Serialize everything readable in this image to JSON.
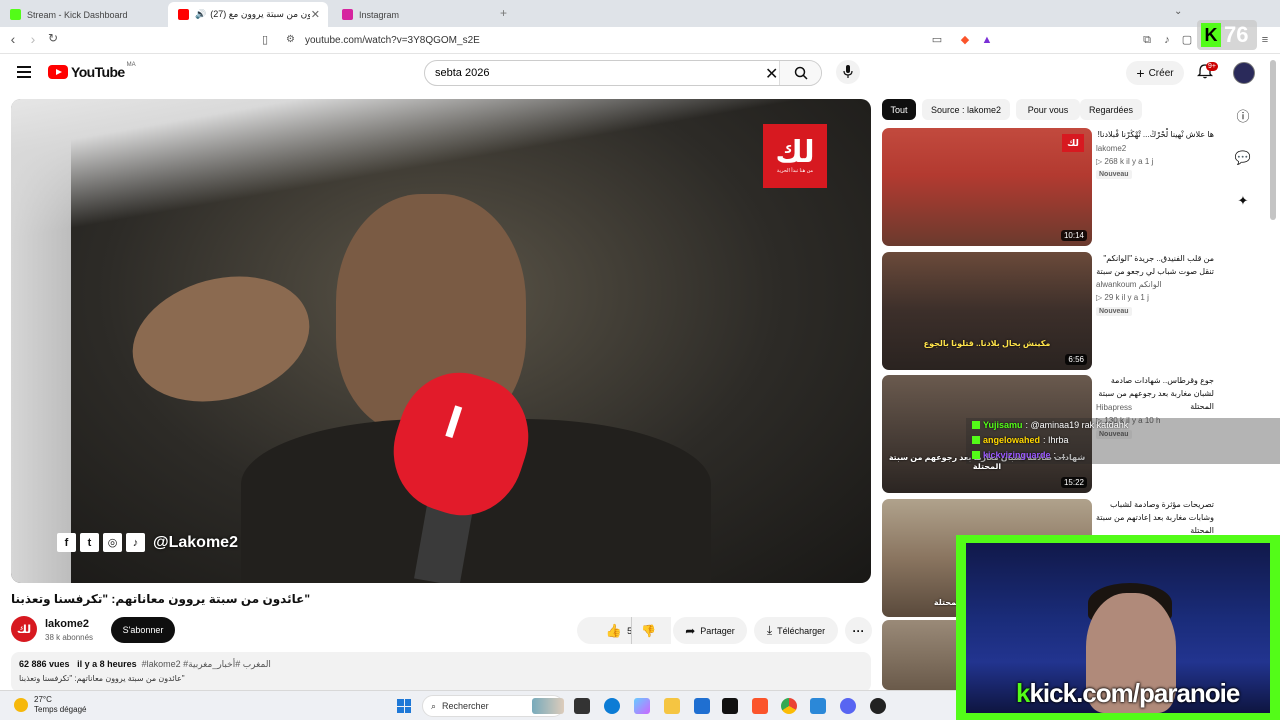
{
  "browser": {
    "tabs": [
      {
        "label": "Stream - Kick Dashboard",
        "color": "#53fc18"
      },
      {
        "label": "(27) عائدون من سبتة يروون مع...",
        "color": "#ff0000"
      },
      {
        "label": "Instagram",
        "color": "#d6249f"
      }
    ],
    "url": "youtube.com/watch?v=3Y8QGOM_s2E"
  },
  "youtube": {
    "logo_word": "YouTube",
    "country_code": "MA",
    "search_value": "sebta 2026",
    "create_label": "Créer",
    "notif_count": "9+"
  },
  "video": {
    "title": "عائدون من سبتة يروون معاناتهم: \"تكرفسنا وتعذبنا\"",
    "channel_bug": "لك",
    "channel_bug_sub": "من هنا تبدأ الحرية",
    "mic_letter": "ا",
    "social_handle": "@Lakome2",
    "channel_name": "lakome2",
    "channel_avatar_text": "لك",
    "subscribers": "38 k abonnés",
    "subscribe_label": "S'abonner",
    "likes": "552",
    "share_label": "Partager",
    "download_label": "Télécharger",
    "views": "62 886 vues",
    "age": "il y a 8 heures",
    "hashtags": "#lakome2 #المغرب #أخبار_مغربية",
    "desc_line": "عائدون من سبتة يروون معاناتهم: \"تكرفسنا وتعذبنا\""
  },
  "chips": [
    "Tout",
    "Source : lakome2",
    "Pour vous",
    "Regardées"
  ],
  "recommendations": [
    {
      "title": "ها علاش نْهينا لْحْرْڭ... تْهْڭرْنا فْبلادنا!",
      "channel": "lakome2",
      "meta": "▷ 268 k   il y a 1 j",
      "badge": "Nouveau",
      "duration": "10:14",
      "caption": ""
    },
    {
      "title": "من قلب الفنيدق.. جريدة \"الوانكم\" تنقل صوت شباب لي رجعو من سبتة",
      "channel": "alwankoum الوانكم",
      "meta": "▷ 29 k   il y a 1 j",
      "badge": "Nouveau",
      "duration": "6:56",
      "caption": "مكينش بحال بلادنا.. قتلونا بالجوع"
    },
    {
      "title": "جوع وقرطاس.. شهادات صادمة لشبان مغاربة بعد رجوعهم من سبتة المحتلة",
      "channel": "Hibapress",
      "meta": "▷ 130 k   il y a 10 h",
      "badge": "Nouveau",
      "duration": "15:22",
      "caption": "شهادات صادمة لشبان مغاربة بعد رجوعهم من سبتة المحتلة"
    },
    {
      "title": "تصريحات مؤثرة وصادمة لشباب وشابات مغاربة بعد إعادتهم من سبتة المحتلة",
      "channel": "",
      "meta": "",
      "badge": "",
      "duration": "",
      "caption": "شباب وشابات سبتة المحتلة"
    }
  ],
  "chat": [
    {
      "user": "Yujisamu",
      "msg": ": @aminaa19 rak katdahk"
    },
    {
      "user": "angelowahed",
      "msg": ": Ihrba"
    },
    {
      "user": "kickvizinguarde",
      "msg": ": ..."
    }
  ],
  "stream_overlay": {
    "kick_url_prefix": "k",
    "kick_url_rest": "kick.com/paranoie",
    "viewer_count": "76"
  },
  "taskbar": {
    "temperature": "27°C",
    "weather": "Temps dégagé",
    "search_placeholder": "Rechercher"
  },
  "colors": {
    "kick_green": "#53fc18",
    "yt_red": "#ff0000",
    "lakome_red": "#d71920"
  }
}
